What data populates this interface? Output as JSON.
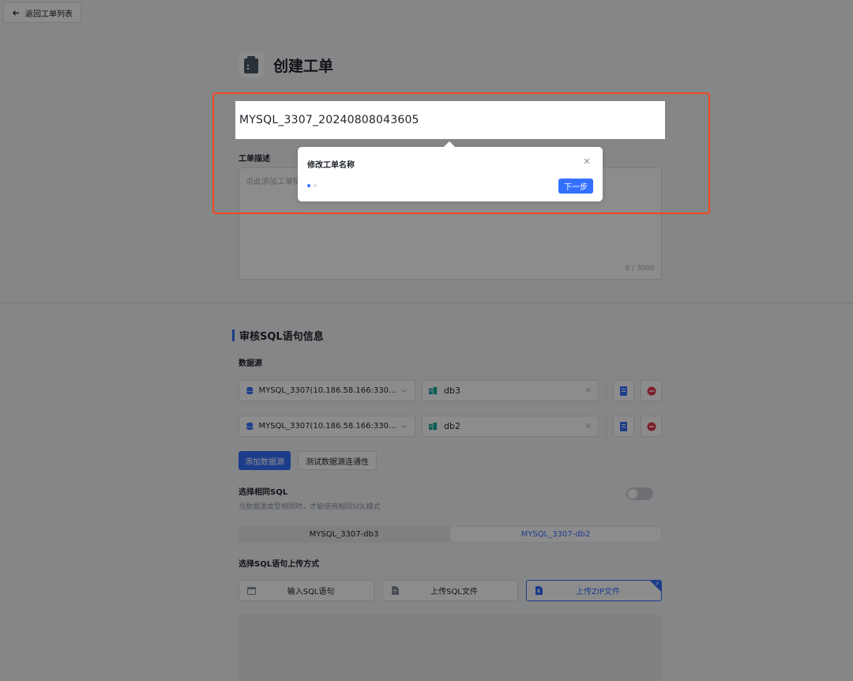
{
  "topbar": {
    "back_label": "返回工单列表"
  },
  "header": {
    "title": "创建工单"
  },
  "form": {
    "name_value": "MYSQL_3307_20240808043605",
    "desc_label": "工单描述",
    "desc_placeholder": "点此添加工单描述",
    "desc_count": "0 / 3000"
  },
  "tooltip": {
    "title": "修改工单名称",
    "next_label": "下一步",
    "close_glyph": "×"
  },
  "sql_section": {
    "title": "审核SQL语句信息",
    "datasource_label": "数据源",
    "datasources": [
      {
        "source": "MYSQL_3307(10.186.58.166:330...",
        "db": "db3",
        "clear": "×"
      },
      {
        "source": "MYSQL_3307(10.186.58.166:330...",
        "db": "db2",
        "clear": "×"
      }
    ],
    "add_ds_label": "添加数据源",
    "test_conn_label": "测试数据源连通性",
    "same_sql_label": "选择相同SQL",
    "same_sql_hint": "当数据源类型相同时，才能使用相同SQL模式",
    "same_sql_enabled": false,
    "tabs": [
      {
        "label": "MYSQL_3307-db3",
        "active": false
      },
      {
        "label": "MYSQL_3307-db2",
        "active": true
      }
    ],
    "upload_label": "选择SQL语句上传方式",
    "upload_options": [
      {
        "label": "输入SQL语句",
        "active": false
      },
      {
        "label": "上传SQL文件",
        "active": false
      },
      {
        "label": "上传ZIP文件",
        "active": true
      }
    ],
    "check_glyph": "✓"
  },
  "colors": {
    "accent": "#3370ff",
    "highlight_border": "#f2491f",
    "danger": "#e8384f",
    "teal": "#14a89a"
  }
}
